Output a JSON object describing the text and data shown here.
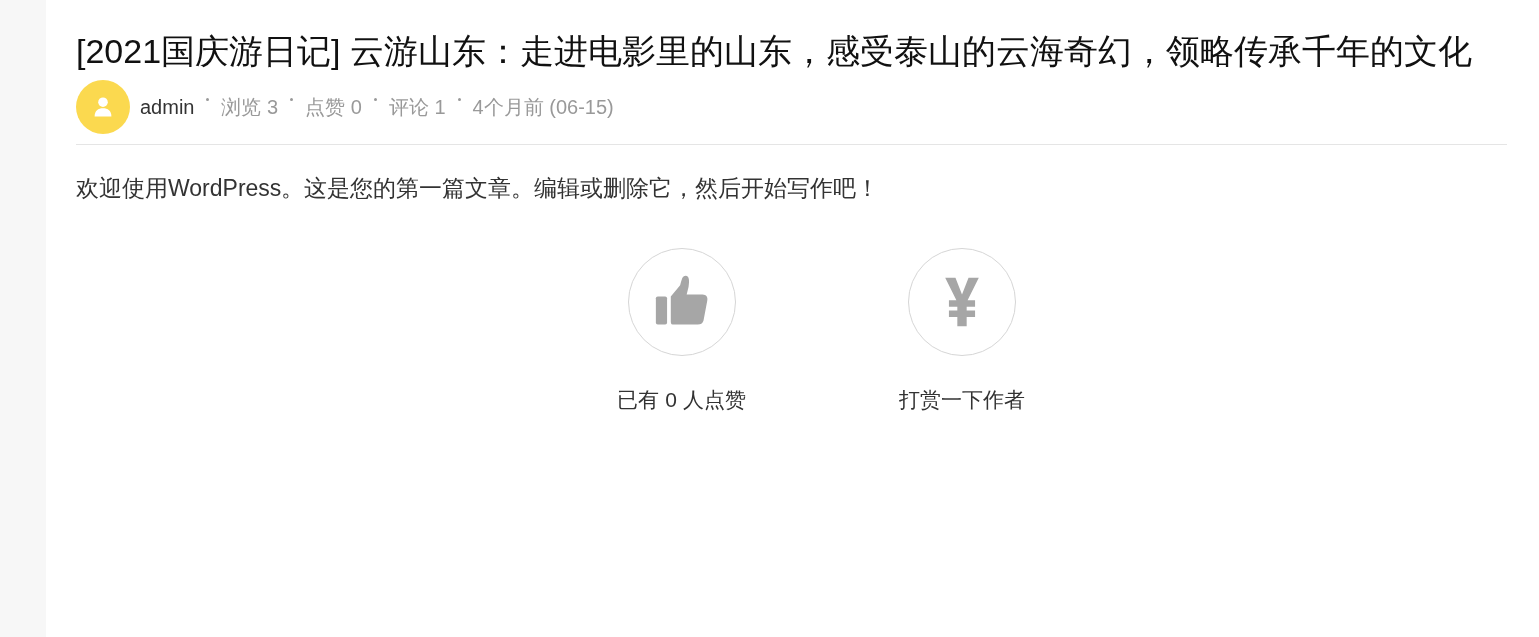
{
  "article": {
    "title": "[2021国庆游日记] 云游山东：走进电影里的山东，感受泰山的云海奇幻，领略传承千年的文化",
    "meta": {
      "author": "admin",
      "items": [
        "浏览 3",
        "点赞 0",
        "评论 1",
        "4个月前 (06-15)"
      ]
    },
    "body": "欢迎使用WordPress。这是您的第一篇文章。编辑或删除它，然后开始写作吧！",
    "actions": [
      {
        "kind": "like",
        "label": "已有 0 人点赞"
      },
      {
        "kind": "reward",
        "label": "打赏一下作者"
      }
    ]
  }
}
